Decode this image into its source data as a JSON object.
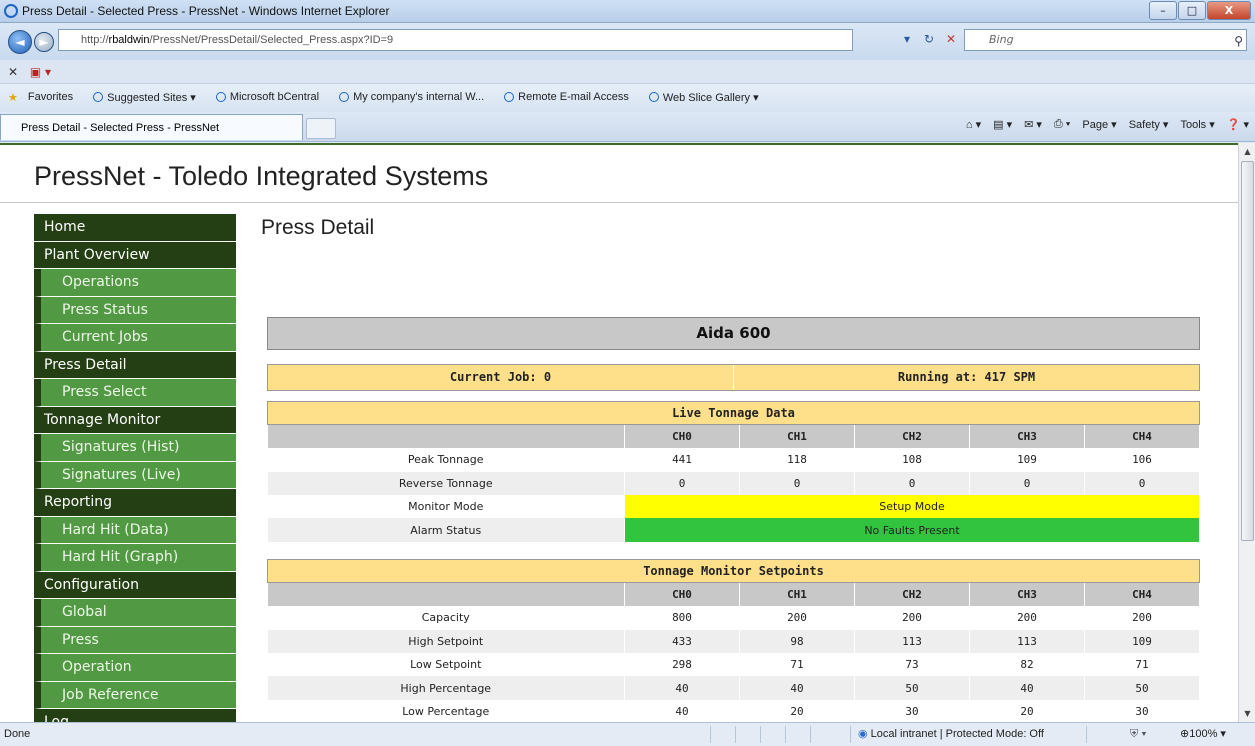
{
  "window": {
    "title": "Press Detail - Selected Press - PressNet - Windows Internet Explorer",
    "min": "–",
    "max": "□",
    "close": "X"
  },
  "browser": {
    "url_prefix": "http://",
    "url_host": "rbaldwin",
    "url_path": "/PressNet/PressDetail/Selected_Press.aspx?ID=9",
    "search_placeholder": "Bing",
    "favorites_label": "Favorites",
    "favorites": [
      "Suggested Sites ▾",
      "Microsoft bCentral",
      "My company's internal W...",
      "Remote E-mail Access",
      "Web Slice Gallery ▾"
    ],
    "tab_title": "Press Detail - Selected Press - PressNet",
    "tools": {
      "page": "Page ▾",
      "safety": "Safety ▾",
      "tools": "Tools ▾"
    },
    "status_left": "Done",
    "status_zone": "Local intranet | Protected Mode: Off",
    "zoom": "100%"
  },
  "site": {
    "title": "PressNet - Toledo Integrated Systems"
  },
  "sidebar": {
    "items": [
      {
        "label": "Home",
        "type": "main"
      },
      {
        "label": "Plant Overview",
        "type": "main"
      },
      {
        "label": "Operations",
        "type": "sub"
      },
      {
        "label": "Press Status",
        "type": "sub"
      },
      {
        "label": "Current Jobs",
        "type": "sub"
      },
      {
        "label": "Press Detail",
        "type": "main"
      },
      {
        "label": "Press Select",
        "type": "sub"
      },
      {
        "label": "Tonnage Monitor",
        "type": "main"
      },
      {
        "label": "Signatures (Hist)",
        "type": "sub"
      },
      {
        "label": "Signatures (Live)",
        "type": "sub"
      },
      {
        "label": "Reporting",
        "type": "main"
      },
      {
        "label": "Hard Hit (Data)",
        "type": "sub"
      },
      {
        "label": "Hard Hit (Graph)",
        "type": "sub"
      },
      {
        "label": "Configuration",
        "type": "main"
      },
      {
        "label": "Global",
        "type": "sub"
      },
      {
        "label": "Press",
        "type": "sub"
      },
      {
        "label": "Operation",
        "type": "sub"
      },
      {
        "label": "Job Reference",
        "type": "sub"
      },
      {
        "label": "Log",
        "type": "main"
      }
    ]
  },
  "main": {
    "page_title": "Press Detail",
    "press_name": "Aida 600",
    "current_job": "Current Job: 0",
    "running": "Running at: 417 SPM"
  },
  "live": {
    "title": "Live Tonnage Data",
    "channels": [
      "CH0",
      "CH1",
      "CH2",
      "CH3",
      "CH4"
    ],
    "peak_label": "Peak Tonnage",
    "peak": [
      "441",
      "118",
      "108",
      "109",
      "106"
    ],
    "reverse_label": "Reverse Tonnage",
    "reverse": [
      "0",
      "0",
      "0",
      "0",
      "0"
    ],
    "mode_label": "Monitor Mode",
    "mode": "Setup Mode",
    "alarm_label": "Alarm Status",
    "alarm": "No Faults Present"
  },
  "setpoints": {
    "title": "Tonnage Monitor Setpoints",
    "channels": [
      "CH0",
      "CH1",
      "CH2",
      "CH3",
      "CH4"
    ],
    "capacity_label": "Capacity",
    "capacity": [
      "800",
      "200",
      "200",
      "200",
      "200"
    ],
    "high_label": "High Setpoint",
    "high": [
      "433",
      "98",
      "113",
      "113",
      "109"
    ],
    "low_label": "Low Setpoint",
    "low": [
      "298",
      "71",
      "73",
      "82",
      "71"
    ],
    "highpct_label": "High Percentage",
    "highpct": [
      "40",
      "40",
      "50",
      "40",
      "50"
    ],
    "lowpct_label": "Low Percentage",
    "lowpct": [
      "40",
      "20",
      "30",
      "20",
      "30"
    ]
  },
  "colors": {
    "nav_dark": "#233f13",
    "nav_light": "#519943",
    "header_yellow": "#ffe08a",
    "setup_yellow": "#ffff00",
    "ok_green": "#33c43f"
  }
}
